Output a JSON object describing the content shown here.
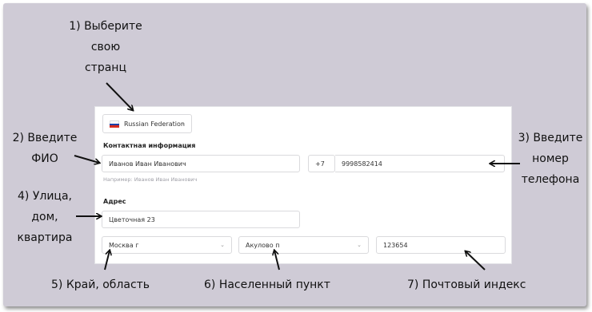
{
  "annotations": {
    "step1": [
      "1) Выберите",
      "свою",
      "странц"
    ],
    "step2": [
      "2) Введите",
      "ФИО"
    ],
    "step3": [
      "3) Введите",
      "номер",
      "телефона"
    ],
    "step4": [
      "4) Улица,",
      "дом,",
      "квартира"
    ],
    "step5": "5) Край, область",
    "step6": "6) Населенный пункт",
    "step7": "7) Почтовый индекс"
  },
  "form": {
    "country": {
      "value": "Russian Federation",
      "flag_colors": [
        "#ffffff",
        "#1c3fa8",
        "#d52b1e"
      ]
    },
    "contact_section_title": "Контактная информация",
    "full_name": {
      "value": "Иванов Иван Иванович",
      "hint": "Например: Иванов Иван Иванович"
    },
    "phone": {
      "code": "+7",
      "number": "9998582414"
    },
    "address_section_title": "Адрес",
    "street": {
      "value": "Цветочная 23"
    },
    "region": {
      "value": "Москва г"
    },
    "locality": {
      "value": "Акулово п"
    },
    "postal_code": {
      "value": "123654"
    }
  },
  "colors": {
    "background": "#cfcbd6",
    "card": "#ffffff",
    "border": "#dadadd",
    "hint": "#a0a0a8"
  }
}
